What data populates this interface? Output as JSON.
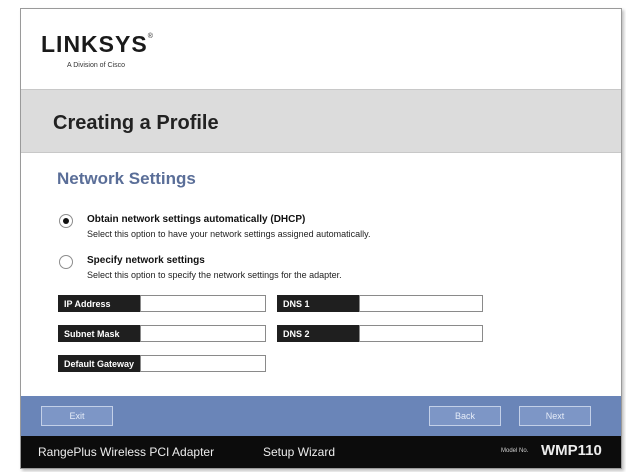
{
  "brand": {
    "logo": "LINKSYS",
    "logo_mark": "®",
    "tagline": "A Division of Cisco"
  },
  "header": {
    "title": "Creating a Profile"
  },
  "section": {
    "title": "Network Settings"
  },
  "options": [
    {
      "label": "Obtain network settings automatically (DHCP)",
      "description": "Select this option to have your network settings assigned automatically.",
      "selected": true
    },
    {
      "label": "Specify network settings",
      "description": "Select this option to specify the network settings for the adapter.",
      "selected": false
    }
  ],
  "fields": {
    "ip_address": {
      "label": "IP Address",
      "value": ""
    },
    "subnet_mask": {
      "label": "Subnet Mask",
      "value": ""
    },
    "default_gateway": {
      "label": "Default Gateway",
      "value": ""
    },
    "dns1": {
      "label": "DNS 1",
      "value": ""
    },
    "dns2": {
      "label": "DNS 2",
      "value": ""
    }
  },
  "buttons": {
    "exit": "Exit",
    "back": "Back",
    "next": "Next"
  },
  "footer": {
    "product": "RangePlus Wireless PCI Adapter",
    "wizard": "Setup Wizard",
    "model_label": "Model No.",
    "model": "WMP110"
  },
  "colors": {
    "section_title": "#5a6e98",
    "button_bar": "#6a85b8",
    "footer_bg": "#0c0c0c",
    "title_bar": "#dcdcdc"
  }
}
